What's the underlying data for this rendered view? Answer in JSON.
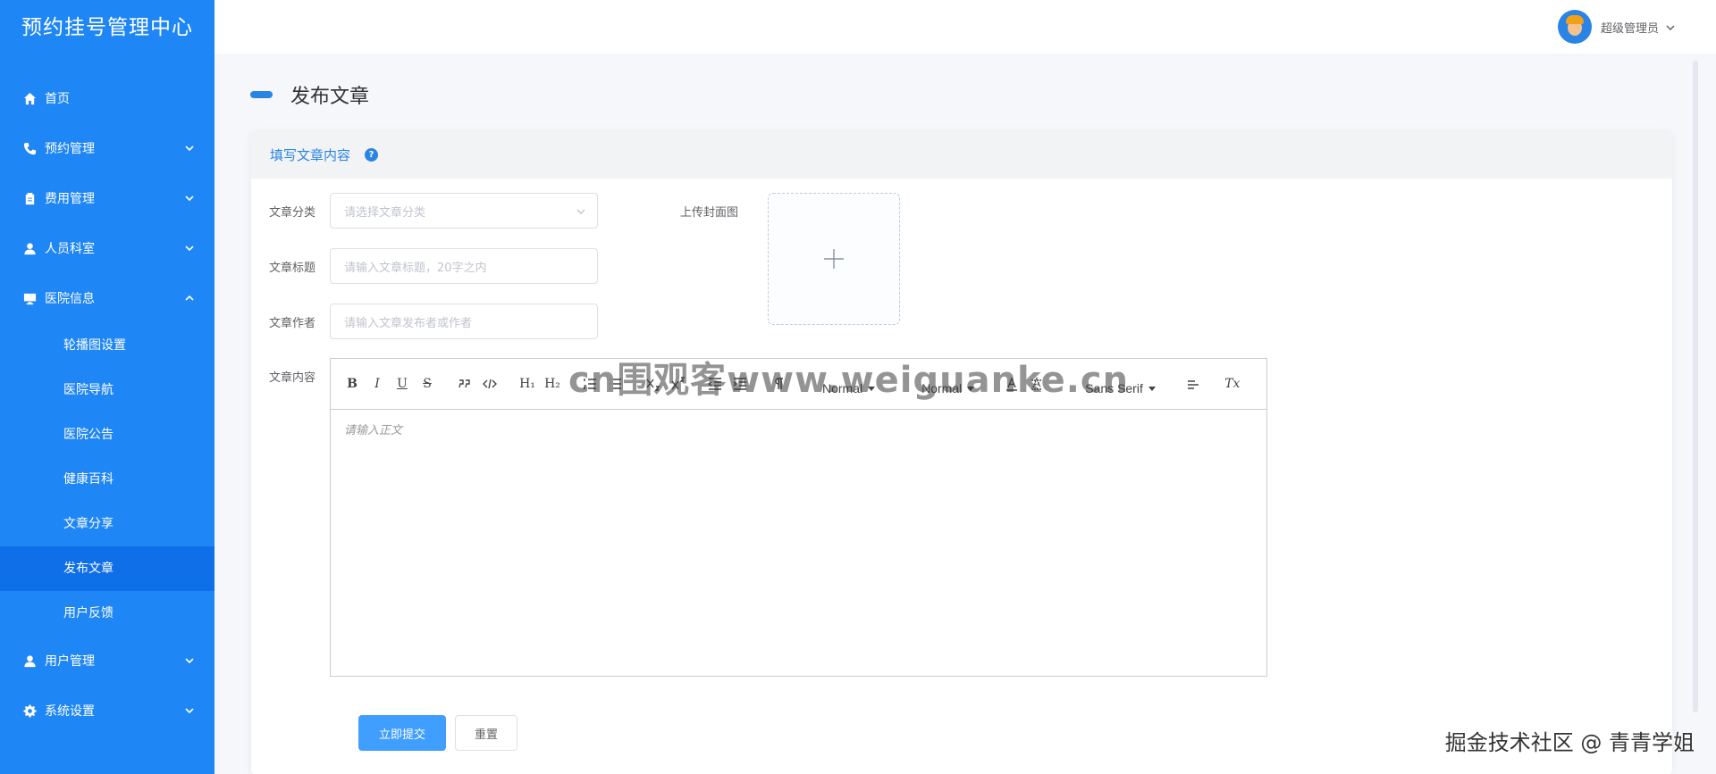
{
  "brand": "预约挂号管理中心",
  "sidebar": {
    "items": [
      {
        "label": "首页",
        "icon": "home-icon"
      },
      {
        "label": "预约管理",
        "icon": "phone-icon"
      },
      {
        "label": "费用管理",
        "icon": "clipboard-icon"
      },
      {
        "label": "人员科室",
        "icon": "person-icon"
      },
      {
        "label": "医院信息",
        "icon": "monitor-icon",
        "expanded": true
      },
      {
        "label": "用户管理",
        "icon": "user-icon"
      },
      {
        "label": "系统设置",
        "icon": "gear-icon"
      }
    ],
    "submenu": [
      {
        "label": "轮播图设置"
      },
      {
        "label": "医院导航"
      },
      {
        "label": "医院公告"
      },
      {
        "label": "健康百科"
      },
      {
        "label": "文章分享"
      },
      {
        "label": "发布文章",
        "active": true
      },
      {
        "label": "用户反馈"
      }
    ]
  },
  "header": {
    "username": "超级管理员"
  },
  "page": {
    "title": "发布文章"
  },
  "card": {
    "title": "填写文章内容",
    "help": "?"
  },
  "form": {
    "category_label": "文章分类",
    "category_placeholder": "请选择文章分类",
    "title_label": "文章标题",
    "title_placeholder": "请输入文章标题，20字之内",
    "author_label": "文章作者",
    "author_placeholder": "请输入文章发布者或作者",
    "cover_label": "上传封面图",
    "content_label": "文章内容",
    "content_placeholder": "请输入正文"
  },
  "toolbar": {
    "bold": "B",
    "italic": "I",
    "underline": "U",
    "strike": "S",
    "h1": "H₁",
    "h2": "H₂",
    "size_value": "Normal",
    "header_value": "Normal",
    "font_value": "Sans Serif",
    "clean": "Tx"
  },
  "buttons": {
    "submit": "立即提交",
    "reset": "重置"
  },
  "watermark": "cn围观客www.weiguanke.cn",
  "credit": "掘金技术社区 @ 青青学姐",
  "colors": {
    "sidebar": "#1f86f5",
    "active": "#0f6fe8",
    "primary": "#409eff",
    "accent": "#2a84e4"
  }
}
